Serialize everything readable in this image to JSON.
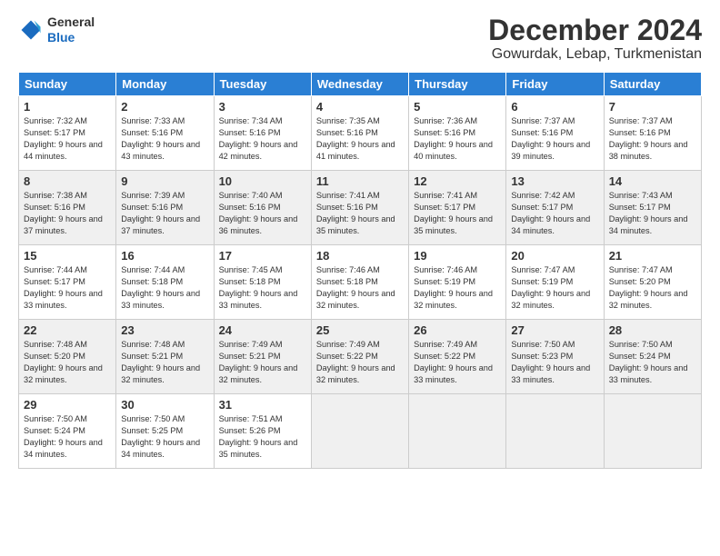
{
  "logo": {
    "general": "General",
    "blue": "Blue"
  },
  "header": {
    "month": "December 2024",
    "location": "Gowurdak, Lebap, Turkmenistan"
  },
  "days_of_week": [
    "Sunday",
    "Monday",
    "Tuesday",
    "Wednesday",
    "Thursday",
    "Friday",
    "Saturday"
  ],
  "weeks": [
    [
      {
        "day": "1",
        "sunrise": "7:32 AM",
        "sunset": "5:17 PM",
        "daylight": "9 hours and 44 minutes."
      },
      {
        "day": "2",
        "sunrise": "7:33 AM",
        "sunset": "5:16 PM",
        "daylight": "9 hours and 43 minutes."
      },
      {
        "day": "3",
        "sunrise": "7:34 AM",
        "sunset": "5:16 PM",
        "daylight": "9 hours and 42 minutes."
      },
      {
        "day": "4",
        "sunrise": "7:35 AM",
        "sunset": "5:16 PM",
        "daylight": "9 hours and 41 minutes."
      },
      {
        "day": "5",
        "sunrise": "7:36 AM",
        "sunset": "5:16 PM",
        "daylight": "9 hours and 40 minutes."
      },
      {
        "day": "6",
        "sunrise": "7:37 AM",
        "sunset": "5:16 PM",
        "daylight": "9 hours and 39 minutes."
      },
      {
        "day": "7",
        "sunrise": "7:37 AM",
        "sunset": "5:16 PM",
        "daylight": "9 hours and 38 minutes."
      }
    ],
    [
      {
        "day": "8",
        "sunrise": "7:38 AM",
        "sunset": "5:16 PM",
        "daylight": "9 hours and 37 minutes."
      },
      {
        "day": "9",
        "sunrise": "7:39 AM",
        "sunset": "5:16 PM",
        "daylight": "9 hours and 37 minutes."
      },
      {
        "day": "10",
        "sunrise": "7:40 AM",
        "sunset": "5:16 PM",
        "daylight": "9 hours and 36 minutes."
      },
      {
        "day": "11",
        "sunrise": "7:41 AM",
        "sunset": "5:16 PM",
        "daylight": "9 hours and 35 minutes."
      },
      {
        "day": "12",
        "sunrise": "7:41 AM",
        "sunset": "5:17 PM",
        "daylight": "9 hours and 35 minutes."
      },
      {
        "day": "13",
        "sunrise": "7:42 AM",
        "sunset": "5:17 PM",
        "daylight": "9 hours and 34 minutes."
      },
      {
        "day": "14",
        "sunrise": "7:43 AM",
        "sunset": "5:17 PM",
        "daylight": "9 hours and 34 minutes."
      }
    ],
    [
      {
        "day": "15",
        "sunrise": "7:44 AM",
        "sunset": "5:17 PM",
        "daylight": "9 hours and 33 minutes."
      },
      {
        "day": "16",
        "sunrise": "7:44 AM",
        "sunset": "5:18 PM",
        "daylight": "9 hours and 33 minutes."
      },
      {
        "day": "17",
        "sunrise": "7:45 AM",
        "sunset": "5:18 PM",
        "daylight": "9 hours and 33 minutes."
      },
      {
        "day": "18",
        "sunrise": "7:46 AM",
        "sunset": "5:18 PM",
        "daylight": "9 hours and 32 minutes."
      },
      {
        "day": "19",
        "sunrise": "7:46 AM",
        "sunset": "5:19 PM",
        "daylight": "9 hours and 32 minutes."
      },
      {
        "day": "20",
        "sunrise": "7:47 AM",
        "sunset": "5:19 PM",
        "daylight": "9 hours and 32 minutes."
      },
      {
        "day": "21",
        "sunrise": "7:47 AM",
        "sunset": "5:20 PM",
        "daylight": "9 hours and 32 minutes."
      }
    ],
    [
      {
        "day": "22",
        "sunrise": "7:48 AM",
        "sunset": "5:20 PM",
        "daylight": "9 hours and 32 minutes."
      },
      {
        "day": "23",
        "sunrise": "7:48 AM",
        "sunset": "5:21 PM",
        "daylight": "9 hours and 32 minutes."
      },
      {
        "day": "24",
        "sunrise": "7:49 AM",
        "sunset": "5:21 PM",
        "daylight": "9 hours and 32 minutes."
      },
      {
        "day": "25",
        "sunrise": "7:49 AM",
        "sunset": "5:22 PM",
        "daylight": "9 hours and 32 minutes."
      },
      {
        "day": "26",
        "sunrise": "7:49 AM",
        "sunset": "5:22 PM",
        "daylight": "9 hours and 33 minutes."
      },
      {
        "day": "27",
        "sunrise": "7:50 AM",
        "sunset": "5:23 PM",
        "daylight": "9 hours and 33 minutes."
      },
      {
        "day": "28",
        "sunrise": "7:50 AM",
        "sunset": "5:24 PM",
        "daylight": "9 hours and 33 minutes."
      }
    ],
    [
      {
        "day": "29",
        "sunrise": "7:50 AM",
        "sunset": "5:24 PM",
        "daylight": "9 hours and 34 minutes."
      },
      {
        "day": "30",
        "sunrise": "7:50 AM",
        "sunset": "5:25 PM",
        "daylight": "9 hours and 34 minutes."
      },
      {
        "day": "31",
        "sunrise": "7:51 AM",
        "sunset": "5:26 PM",
        "daylight": "9 hours and 35 minutes."
      },
      null,
      null,
      null,
      null
    ]
  ],
  "labels": {
    "sunrise": "Sunrise:",
    "sunset": "Sunset:",
    "daylight": "Daylight:"
  }
}
